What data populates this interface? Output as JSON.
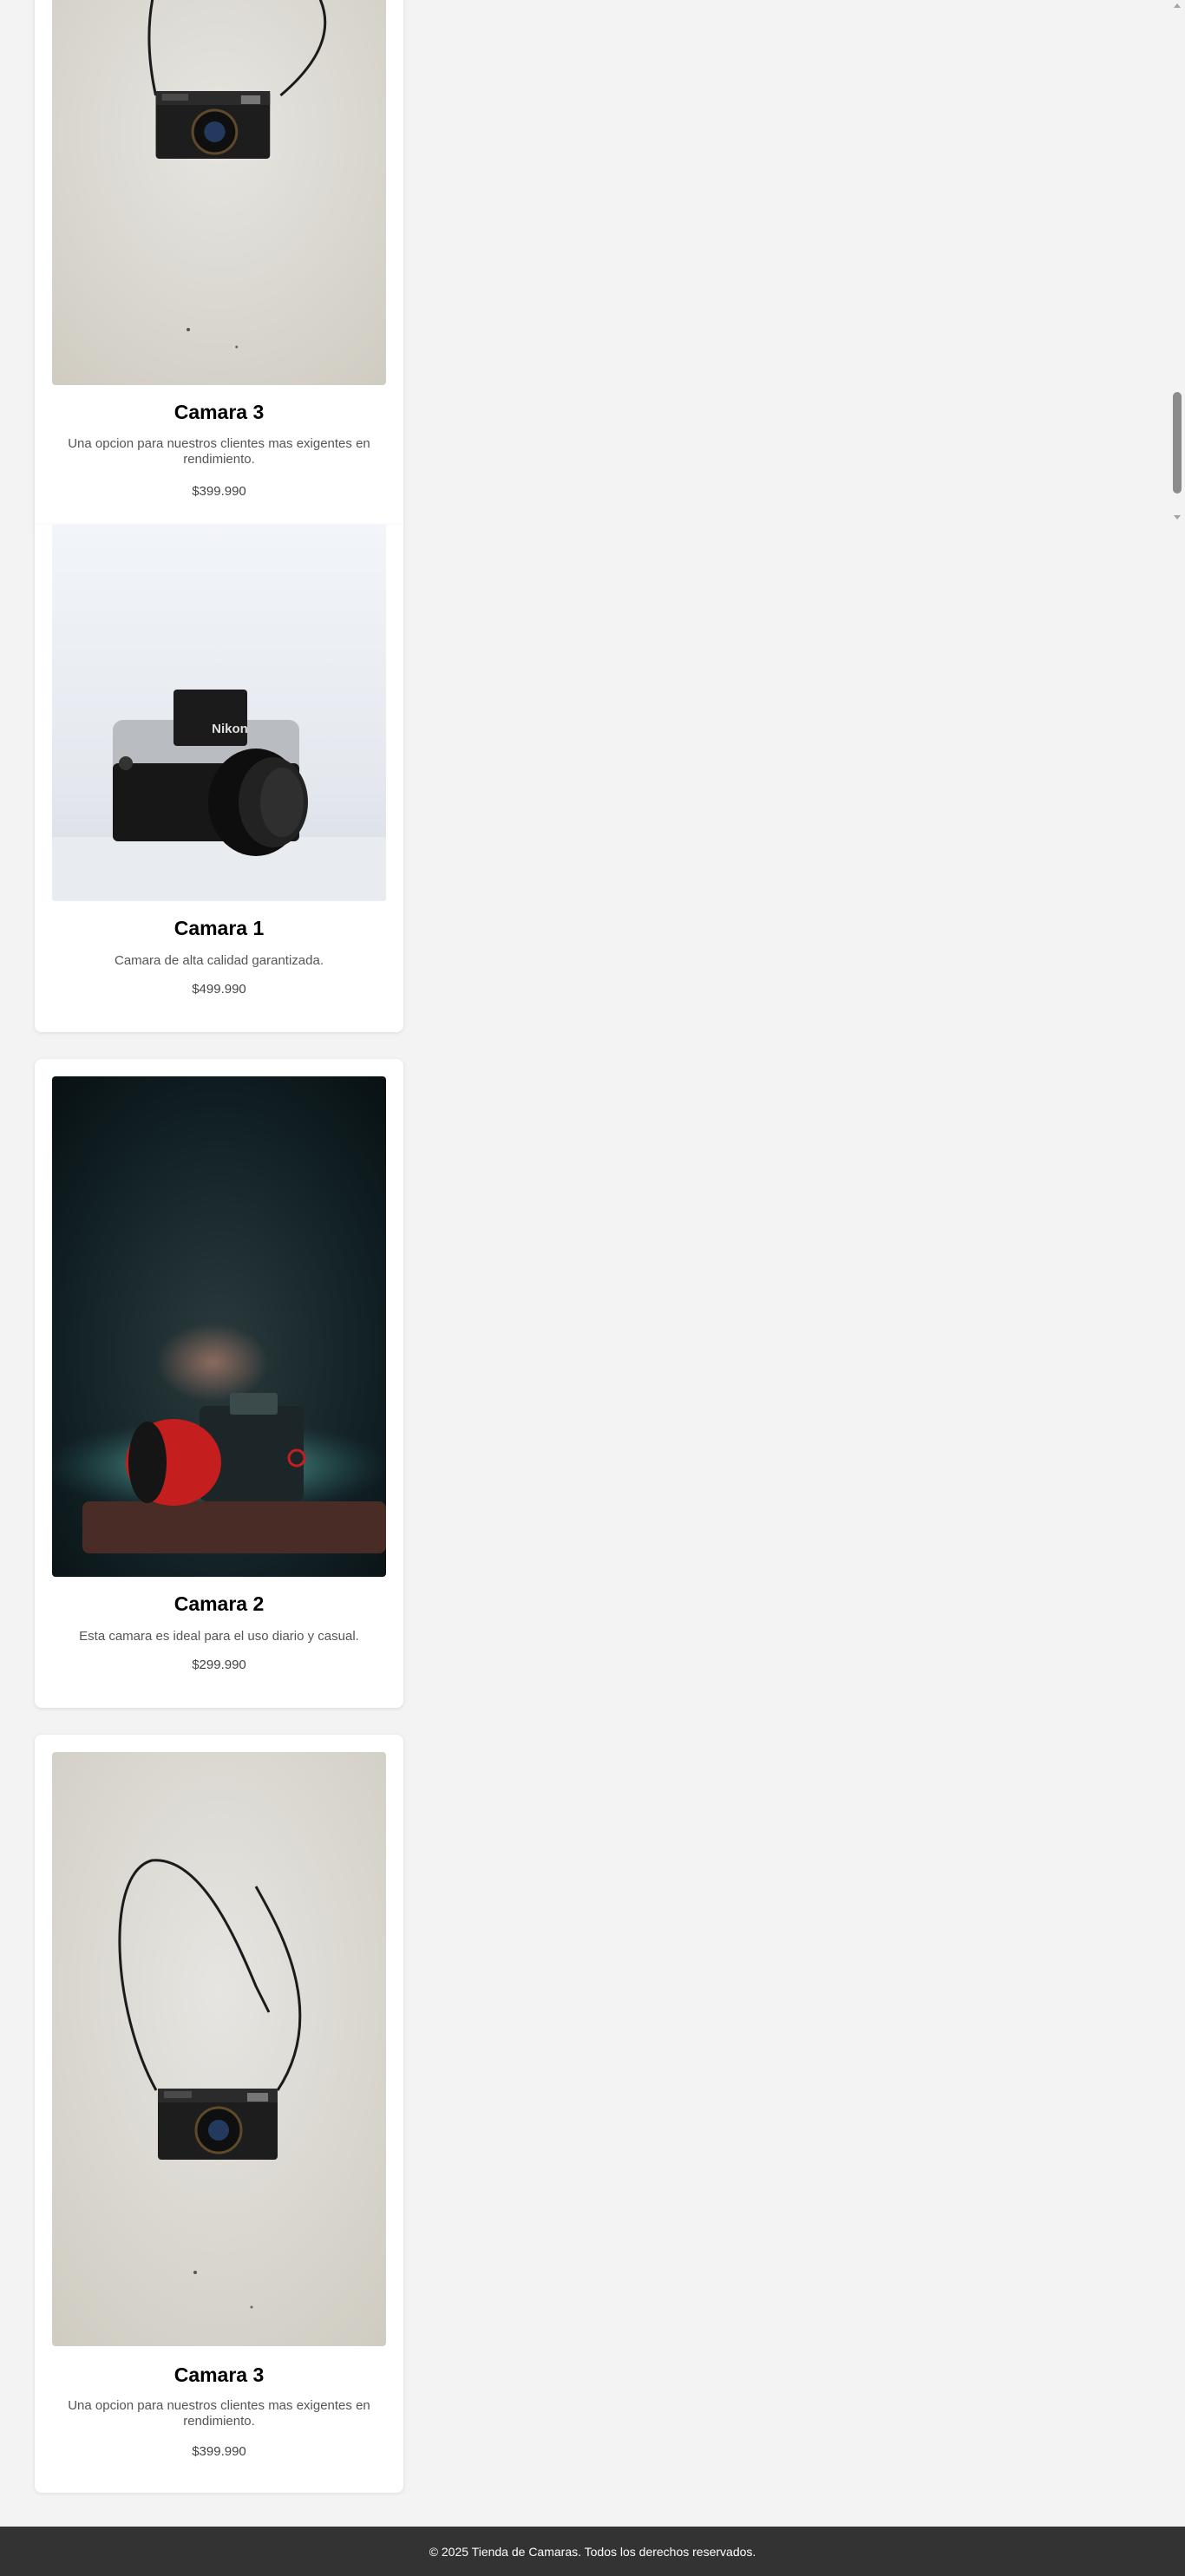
{
  "products": [
    {
      "name": "Camara 3",
      "description": "Una opcion para nuestros clientes mas exigentes en rendimiento.",
      "price": "$399.990"
    },
    {
      "name": "Camara 1",
      "description": "Camara de alta calidad garantizada.",
      "price": "$499.990"
    },
    {
      "name": "Camara 2",
      "description": "Esta camara es ideal para el uso diario y casual.",
      "price": "$299.990"
    },
    {
      "name": "Camara 3",
      "description": "Una opcion para nuestros clientes mas exigentes en rendimiento.",
      "price": "$399.990"
    }
  ],
  "photo_text": {
    "nikon_brand": "Nikon"
  },
  "footer": {
    "copyright": "© 2025 Tienda de Camaras. Todos los derechos reservados."
  }
}
